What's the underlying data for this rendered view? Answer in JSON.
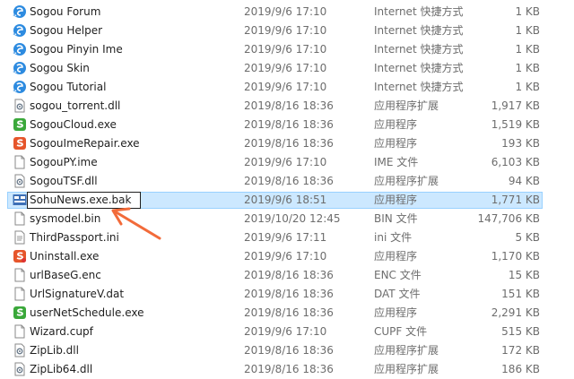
{
  "files": [
    {
      "name": "Sogou Forum",
      "date": "2019/9/6 17:10",
      "type": "Internet 快捷方式",
      "size": "1 KB",
      "icon": "internet-shortcut-icon"
    },
    {
      "name": "Sogou Helper",
      "date": "2019/9/6 17:10",
      "type": "Internet 快捷方式",
      "size": "1 KB",
      "icon": "internet-shortcut-icon"
    },
    {
      "name": "Sogou Pinyin Ime",
      "date": "2019/9/6 17:10",
      "type": "Internet 快捷方式",
      "size": "1 KB",
      "icon": "internet-shortcut-icon"
    },
    {
      "name": "Sogou Skin",
      "date": "2019/9/6 17:10",
      "type": "Internet 快捷方式",
      "size": "1 KB",
      "icon": "internet-shortcut-icon"
    },
    {
      "name": "Sogou Tutorial",
      "date": "2019/9/6 17:10",
      "type": "Internet 快捷方式",
      "size": "1 KB",
      "icon": "internet-shortcut-icon"
    },
    {
      "name": "sogou_torrent.dll",
      "date": "2019/8/16 18:36",
      "type": "应用程序扩展",
      "size": "1,917 KB",
      "icon": "dll-file-icon"
    },
    {
      "name": "SogouCloud.exe",
      "date": "2019/8/16 18:36",
      "type": "应用程序",
      "size": "1,519 KB",
      "icon": "sogou-app-icon"
    },
    {
      "name": "SogouImeRepair.exe",
      "date": "2019/8/16 18:36",
      "type": "应用程序",
      "size": "193 KB",
      "icon": "sogou-repair-icon"
    },
    {
      "name": "SogouPY.ime",
      "date": "2019/9/6 17:10",
      "type": "IME 文件",
      "size": "6,103 KB",
      "icon": "blank-file-icon"
    },
    {
      "name": "SogouTSF.dll",
      "date": "2019/8/16 18:36",
      "type": "应用程序扩展",
      "size": "94 KB",
      "icon": "dll-file-icon"
    },
    {
      "name": "SohuNews.exe.bak",
      "date": "2019/9/6 18:51",
      "type": "应用程序",
      "size": "1,771 KB",
      "icon": "sohu-news-icon",
      "selected": true,
      "renaming": true
    },
    {
      "name": "sysmodel.bin",
      "date": "2019/10/20 12:45",
      "type": "BIN 文件",
      "size": "147,706 KB",
      "icon": "blank-file-icon"
    },
    {
      "name": "ThirdPassport.ini",
      "date": "2019/9/6 17:11",
      "type": "ini 文件",
      "size": "5 KB",
      "icon": "ini-file-icon"
    },
    {
      "name": "Uninstall.exe",
      "date": "2019/9/6 17:10",
      "type": "应用程序",
      "size": "1,170 KB",
      "icon": "uninstall-app-icon"
    },
    {
      "name": "urlBaseG.enc",
      "date": "2019/8/16 18:36",
      "type": "ENC 文件",
      "size": "15 KB",
      "icon": "blank-file-icon"
    },
    {
      "name": "UrlSignatureV.dat",
      "date": "2019/8/16 18:36",
      "type": "DAT 文件",
      "size": "151 KB",
      "icon": "blank-file-icon"
    },
    {
      "name": "userNetSchedule.exe",
      "date": "2019/8/16 18:36",
      "type": "应用程序",
      "size": "2,291 KB",
      "icon": "sogou-app-icon"
    },
    {
      "name": "Wizard.cupf",
      "date": "2019/9/6 17:10",
      "type": "CUPF 文件",
      "size": "515 KB",
      "icon": "blank-file-icon"
    },
    {
      "name": "ZipLib.dll",
      "date": "2019/8/16 18:36",
      "type": "应用程序扩展",
      "size": "172 KB",
      "icon": "dll-file-icon"
    },
    {
      "name": "ZipLib64.dll",
      "date": "2019/8/16 18:36",
      "type": "应用程序扩展",
      "size": "186 KB",
      "icon": "dll-file-icon"
    }
  ],
  "colors": {
    "selection_bg": "#cce8ff",
    "selection_border": "#99d1ff",
    "annotation_arrow": "#f26b3a",
    "muted_text": "#6d6d6d"
  }
}
